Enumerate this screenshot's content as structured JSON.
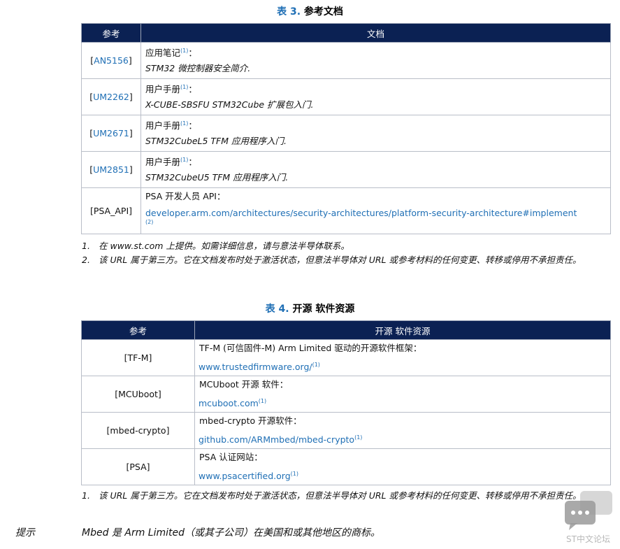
{
  "table3": {
    "caption_num": "表 3.",
    "caption_title": "参考文档",
    "header": {
      "ref": "参考",
      "doc": "文档"
    },
    "rows": [
      {
        "ref_open": "[",
        "ref_id": "AN5156",
        "ref_close": "]",
        "type": "应用笔记",
        "sup": "(1)",
        "colon": "：",
        "title": "STM32 微控制器安全简介."
      },
      {
        "ref_open": "[",
        "ref_id": "UM2262",
        "ref_close": "]",
        "type": "用户手册",
        "sup": "(1)",
        "colon": "：",
        "title": "X-CUBE-SBSFU STM32Cube 扩展包入门."
      },
      {
        "ref_open": "[",
        "ref_id": "UM2671",
        "ref_close": "]",
        "type": "用户手册",
        "sup": "(1)",
        "colon": "：",
        "title": "STM32CubeL5 TFM 应用程序入门."
      },
      {
        "ref_open": "[",
        "ref_id": "UM2851",
        "ref_close": "]",
        "type": "用户手册",
        "sup": "(1)",
        "colon": "：",
        "title": "STM32CubeU5 TFM 应用程序入门."
      }
    ],
    "psa_row": {
      "ref": "[PSA_API]",
      "line1": "PSA 开发人员 API：",
      "url": "developer.arm.com/architectures/security-architectures/platform-security-architecture#implement",
      "sup": "(2)"
    },
    "notes": [
      {
        "idx": "1.",
        "text": "在 www.st.com 上提供。如需详细信息，请与意法半导体联系。"
      },
      {
        "idx": "2.",
        "text": "该 URL 属于第三方。它在文档发布时处于激活状态，但意法半导体对 URL 或参考材料的任何变更、转移或停用不承担责任。"
      }
    ]
  },
  "table4": {
    "caption_num": "表 4.",
    "caption_title": "开源 软件资源",
    "header": {
      "ref": "参考",
      "doc": "开源 软件资源"
    },
    "rows": [
      {
        "ref": "[TF-M]",
        "line1": "TF-M (可信固件-M) Arm Limited 驱动的开源软件框架：",
        "url": "www.trustedfirmware.org/",
        "sup": "(1)"
      },
      {
        "ref": "[MCUboot]",
        "line1": "MCUboot 开源 软件：",
        "url": "mcuboot.com",
        "sup": "(1)"
      },
      {
        "ref": "[mbed-crypto]",
        "line1": "mbed-crypto 开源软件：",
        "url": "github.com/ARMmbed/mbed-crypto",
        "sup": "(1)"
      },
      {
        "ref": "[PSA]",
        "line1": "PSA 认证网站：",
        "url": "www.psacertified.org",
        "sup": "(1)"
      }
    ],
    "notes": [
      {
        "idx": "1.",
        "text": "该 URL 属于第三方。它在文档发布时处于激活状态，但意法半导体对 URL 或参考材料的任何变更、转移或停用不承担责任。"
      }
    ]
  },
  "tip": {
    "label": "提示",
    "text": "Mbed 是 Arm Limited（或其子公司）在美国和或其他地区的商标。"
  },
  "watermark": {
    "text": "ST中文论坛",
    "icon": "chat-bubbles-icon"
  }
}
